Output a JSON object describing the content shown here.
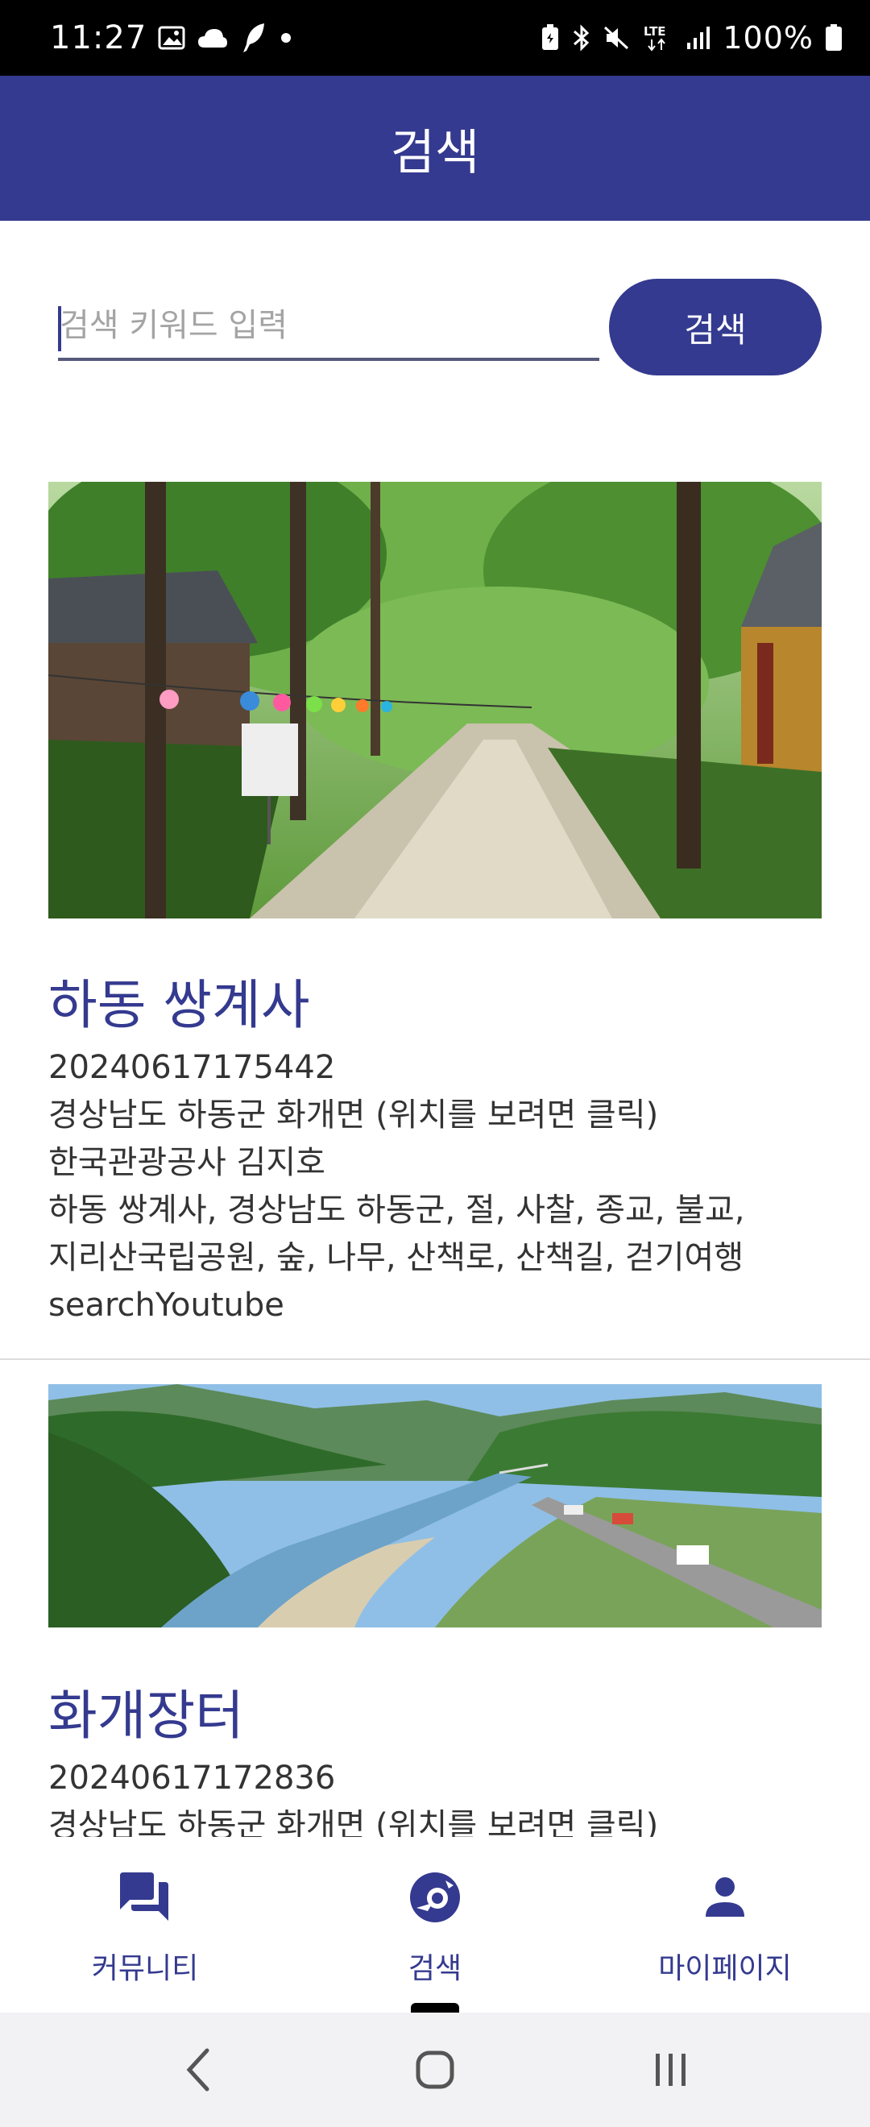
{
  "status_bar": {
    "time": "11:27",
    "battery_percent": "100%",
    "left_icons": [
      "image-icon",
      "cloud-icon",
      "feather-icon",
      "dot-icon"
    ],
    "right_icons": [
      "battery-saver-icon",
      "bluetooth-icon",
      "mute-icon",
      "lte-icon",
      "signal-icon",
      "battery-icon"
    ]
  },
  "app_bar": {
    "title": "검색"
  },
  "search": {
    "placeholder": "검색 키워드 입력",
    "value": "",
    "button_label": "검색"
  },
  "results": [
    {
      "title": "하동 쌍계사",
      "id": "20240617175442",
      "address": "경상남도 하동군 화개면 (위치를 보려면 클릭)",
      "photographer": "한국관광공사 김지호",
      "keywords_line1": "하동 쌍계사, 경상남도 하동군, 절, 사찰, 종교, 불교,",
      "keywords_line2": "지리산국립공원, 숲, 나무, 산책로, 산책길, 걷기여행",
      "youtube_link": "searchYoutube"
    },
    {
      "title": "화개장터",
      "id": "20240617172836",
      "address": "경상남도 하동군 화개면 (위치를 보려면 클릭)"
    }
  ],
  "bottom_nav": {
    "items": [
      {
        "label": "커뮤니티",
        "icon": "forum-icon"
      },
      {
        "label": "검색",
        "icon": "explore-search-icon",
        "selected": true
      },
      {
        "label": "마이페이지",
        "icon": "person-icon"
      }
    ]
  },
  "system_nav": {
    "buttons": [
      "back-icon",
      "home-icon",
      "recents-icon"
    ]
  },
  "colors": {
    "primary": "#343a8f",
    "status_bar": "#000000",
    "background": "#ffffff",
    "text": "#333333",
    "system_nav_bg": "#f2f2f4"
  }
}
